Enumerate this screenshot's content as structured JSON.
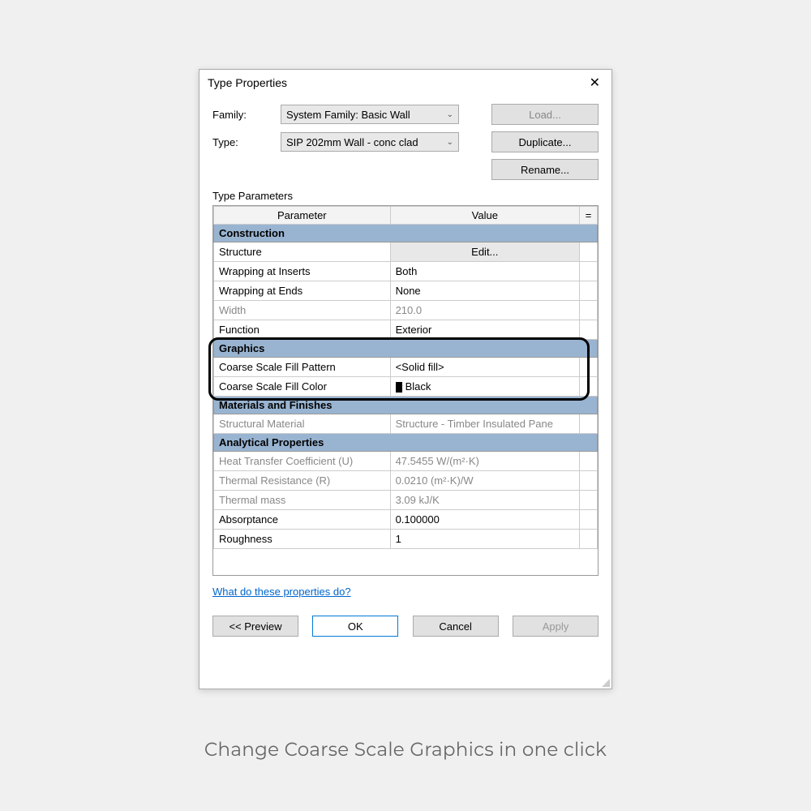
{
  "dialog": {
    "title": "Type Properties",
    "family_label": "Family:",
    "family_value": "System Family: Basic Wall",
    "type_label": "Type:",
    "type_value": "SIP 202mm Wall - conc clad",
    "load_btn": "Load...",
    "duplicate_btn": "Duplicate...",
    "rename_btn": "Rename...",
    "section_label": "Type Parameters",
    "columns": {
      "param": "Parameter",
      "value": "Value",
      "eq": "="
    },
    "link": "What do these properties do?",
    "footer": {
      "preview": "<<  Preview",
      "ok": "OK",
      "cancel": "Cancel",
      "apply": "Apply"
    }
  },
  "groups": [
    {
      "name": "Construction",
      "rows": [
        {
          "param": "Structure",
          "value": "Edit...",
          "value_is_button": true
        },
        {
          "param": "Wrapping at Inserts",
          "value": "Both"
        },
        {
          "param": "Wrapping at Ends",
          "value": "None"
        },
        {
          "param": "Width",
          "value": "210.0",
          "disabled": true
        },
        {
          "param": "Function",
          "value": "Exterior"
        }
      ]
    },
    {
      "name": "Graphics",
      "highlight": true,
      "rows": [
        {
          "param": "Coarse Scale Fill Pattern",
          "value": "<Solid fill>"
        },
        {
          "param": "Coarse Scale Fill Color",
          "value": "Black",
          "color_swatch": "#000000"
        }
      ]
    },
    {
      "name": "Materials and Finishes",
      "rows": [
        {
          "param": "Structural Material",
          "value": "Structure - Timber Insulated Pane",
          "disabled": true
        }
      ]
    },
    {
      "name": "Analytical Properties",
      "rows": [
        {
          "param": "Heat Transfer Coefficient (U)",
          "value": "47.5455 W/(m²·K)",
          "disabled": true
        },
        {
          "param": "Thermal Resistance (R)",
          "value": "0.0210 (m²·K)/W",
          "disabled": true
        },
        {
          "param": "Thermal mass",
          "value": "3.09 kJ/K",
          "disabled": true
        },
        {
          "param": "Absorptance",
          "value": "0.100000"
        },
        {
          "param": "Roughness",
          "value": "1"
        }
      ]
    }
  ],
  "caption": "Change Coarse Scale Graphics in one click"
}
